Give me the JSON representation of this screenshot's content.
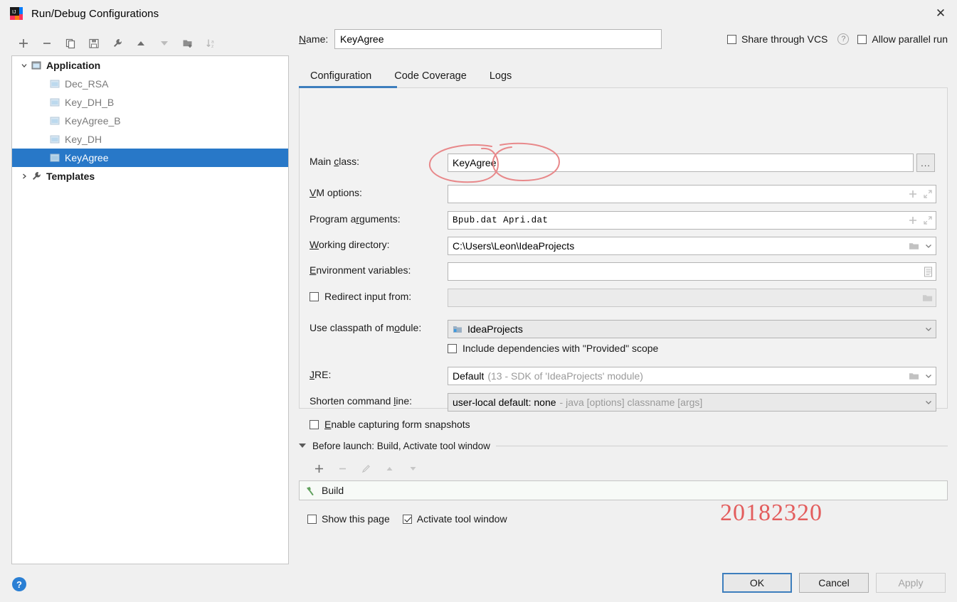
{
  "window": {
    "title": "Run/Debug Configurations",
    "app_icon": "intellij-idea-icon",
    "close_label": "✕"
  },
  "left_toolbar": {
    "buttons": [
      {
        "name": "add-configuration-button",
        "icon": "plus-icon",
        "label": "+"
      },
      {
        "name": "remove-configuration-button",
        "icon": "minus-icon",
        "label": "−"
      },
      {
        "name": "copy-configuration-button",
        "icon": "copy-icon",
        "label": "Copy"
      },
      {
        "name": "save-configuration-button",
        "icon": "save-icon",
        "label": "Save"
      },
      {
        "name": "edit-templates-button",
        "icon": "wrench-icon",
        "label": "Edit Templates"
      },
      {
        "name": "move-up-button",
        "icon": "arrow-up-icon",
        "label": "Move Up"
      },
      {
        "name": "move-down-button",
        "icon": "arrow-down-icon",
        "label": "Move Down"
      },
      {
        "name": "new-folder-button",
        "icon": "folder-add-icon",
        "label": "New Folder"
      },
      {
        "name": "sort-configurations-button",
        "icon": "sort-alpha-icon",
        "label": "Sort Configurations"
      }
    ]
  },
  "tree": {
    "groups": [
      {
        "label": "Application",
        "icon": "application-group-icon",
        "expanded": true,
        "children": [
          {
            "label": "Dec_RSA",
            "icon": "run-config-icon",
            "selected": false
          },
          {
            "label": "Key_DH_B",
            "icon": "run-config-icon",
            "selected": false
          },
          {
            "label": "KeyAgree_B",
            "icon": "run-config-icon",
            "selected": false
          },
          {
            "label": "Key_DH",
            "icon": "run-config-icon",
            "selected": false
          },
          {
            "label": "KeyAgree",
            "icon": "run-config-icon",
            "selected": true
          }
        ]
      },
      {
        "label": "Templates",
        "icon": "templates-wrench-icon",
        "expanded": false,
        "children": []
      }
    ]
  },
  "header": {
    "name_label": "Name:",
    "name_value": "KeyAgree",
    "share_vcs_label": "Share through VCS",
    "share_vcs_checked": false,
    "help_icon": "question-mark-icon",
    "allow_parallel_label": "Allow parallel run",
    "allow_parallel_checked": false
  },
  "tabs": [
    {
      "label": "Configuration",
      "active": true
    },
    {
      "label": "Code Coverage",
      "active": false
    },
    {
      "label": "Logs",
      "active": false
    }
  ],
  "form": {
    "main_class": {
      "label": "Main class:",
      "value": "KeyAgree",
      "browse_label": "..."
    },
    "vm_options": {
      "label": "VM options:",
      "value": "",
      "adornments": [
        "plus-icon",
        "expand-icon"
      ]
    },
    "program_arguments": {
      "label": "Program arguments:",
      "value": "Bpub.dat Apri.dat",
      "adornments": [
        "plus-icon",
        "expand-icon"
      ]
    },
    "working_directory": {
      "label": "Working directory:",
      "value": "C:\\Users\\Leon\\IdeaProjects",
      "adornments": [
        "folder-icon",
        "chevron-down-icon"
      ]
    },
    "environment_variables": {
      "label": "Environment variables:",
      "value": "",
      "adornments": [
        "list-editor-icon"
      ]
    },
    "redirect_input": {
      "label": "Redirect input from:",
      "checked": false,
      "value": "",
      "disabled": true,
      "adornments": [
        "folder-icon"
      ]
    },
    "use_classpath": {
      "label": "Use classpath of module:",
      "value": "IdeaProjects",
      "icon": "module-icon",
      "adornments": [
        "chevron-down-icon"
      ]
    },
    "include_dependencies": {
      "label": "Include dependencies with \"Provided\" scope",
      "checked": false
    },
    "jre": {
      "label": "JRE:",
      "value": "Default",
      "hint": "(13 - SDK of 'IdeaProjects' module)",
      "adornments": [
        "folder-icon",
        "chevron-down-icon"
      ]
    },
    "shorten_command_line": {
      "label": "Shorten command line:",
      "value": "user-local default: none",
      "hint": "- java [options] classname [args]",
      "adornments": [
        "chevron-down-icon"
      ]
    },
    "enable_snapshots": {
      "label": "Enable capturing form snapshots",
      "checked": false
    }
  },
  "before_launch": {
    "header": "Before launch: Build, Activate tool window",
    "toolbar": [
      {
        "name": "add-task-button",
        "icon": "plus-icon",
        "label": "+"
      },
      {
        "name": "remove-task-button",
        "icon": "minus-icon",
        "label": "−"
      },
      {
        "name": "edit-task-button",
        "icon": "pencil-icon",
        "label": "Edit"
      },
      {
        "name": "task-move-up-button",
        "icon": "arrow-up-icon",
        "label": "Up"
      },
      {
        "name": "task-move-down-button",
        "icon": "arrow-down-icon",
        "label": "Down"
      }
    ],
    "tasks": [
      {
        "label": "Build",
        "icon": "hammer-icon"
      }
    ],
    "show_page_label": "Show this page",
    "show_page_checked": false,
    "activate_tool_window_label": "Activate tool window",
    "activate_tool_window_checked": true
  },
  "annotation": {
    "watermark_text": "20182320",
    "watermark_color": "#e35d5d",
    "circle_color": "#e8888a"
  },
  "footer": {
    "help_icon": "help-circle-icon",
    "ok_label": "OK",
    "cancel_label": "Cancel",
    "apply_label": "Apply",
    "apply_disabled": true
  }
}
